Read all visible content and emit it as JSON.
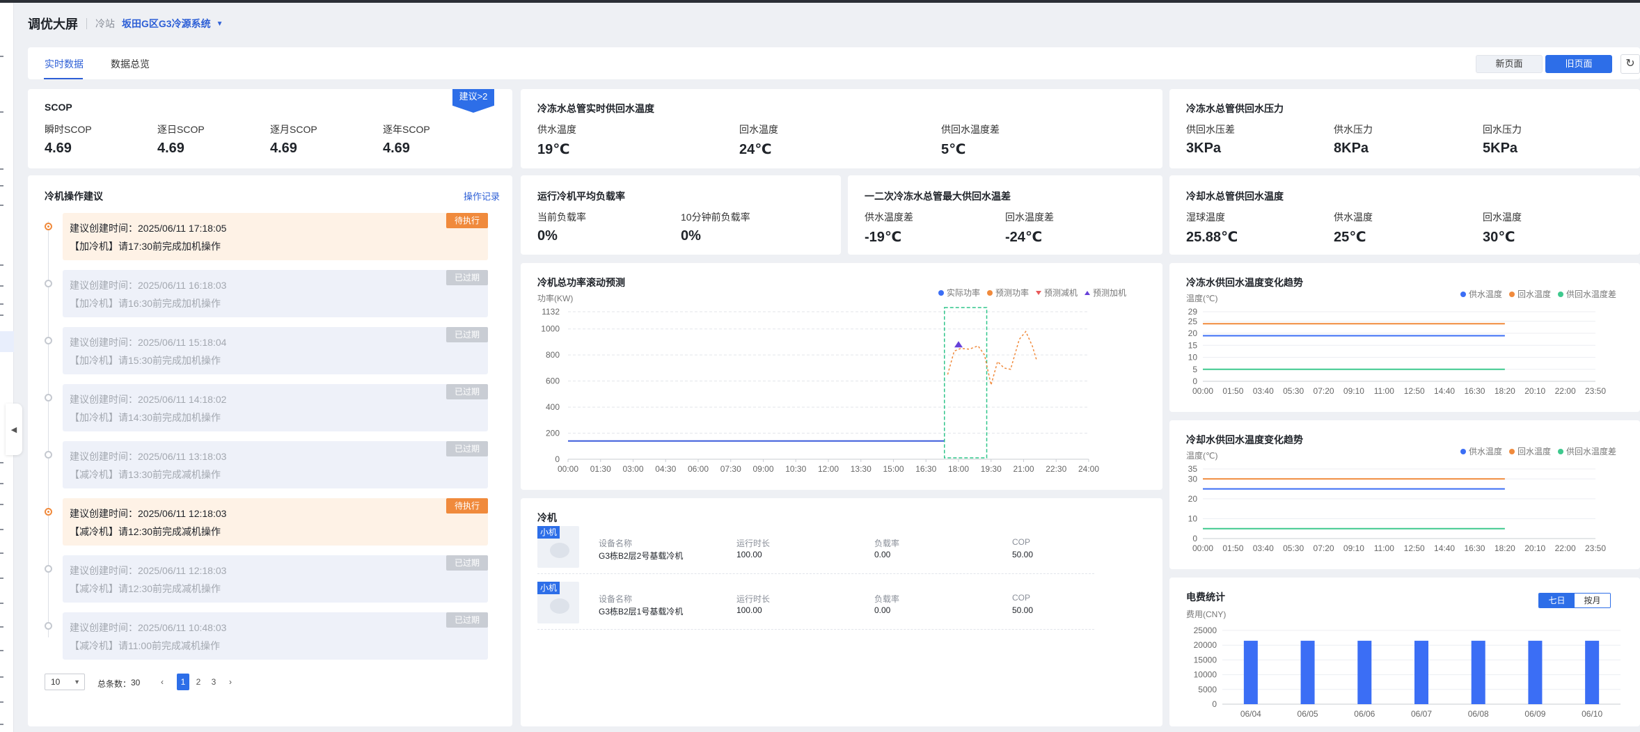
{
  "header": {
    "title": "调优大屏",
    "station_label": "冷站",
    "station_value": "坂田G区G3冷源系统"
  },
  "tabs": [
    {
      "label": "实时数据",
      "active": true
    },
    {
      "label": "数据总览",
      "active": false
    }
  ],
  "actions": {
    "new_page": "新页面",
    "old_page": "旧页面"
  },
  "scop": {
    "title": "SCOP",
    "badge": "建议>2",
    "metrics": [
      {
        "label": "瞬时SCOP",
        "value": "4.69"
      },
      {
        "label": "逐日SCOP",
        "value": "4.69"
      },
      {
        "label": "逐月SCOP",
        "value": "4.69"
      },
      {
        "label": "逐年SCOP",
        "value": "4.69"
      }
    ]
  },
  "chw_temp": {
    "title": "冷冻水总管实时供回水温度",
    "metrics": [
      {
        "label": "供水温度",
        "value": "19℃"
      },
      {
        "label": "回水温度",
        "value": "24℃"
      },
      {
        "label": "供回水温度差",
        "value": "5℃"
      }
    ]
  },
  "chw_pressure": {
    "title": "冷冻水总管供回水压力",
    "metrics": [
      {
        "label": "供回水压差",
        "value": "3KPa"
      },
      {
        "label": "供水压力",
        "value": "8KPa"
      },
      {
        "label": "回水压力",
        "value": "5KPa"
      }
    ]
  },
  "load": {
    "title": "运行冷机平均负载率",
    "metrics": [
      {
        "label": "当前负载率",
        "value": "0%"
      },
      {
        "label": "10分钟前负载率",
        "value": "0%"
      }
    ]
  },
  "max_diff": {
    "title": "一二次冷冻水总管最大供回水温差",
    "metrics": [
      {
        "label": "供水温度差",
        "value": "-19℃"
      },
      {
        "label": "回水温度差",
        "value": "-24℃"
      }
    ]
  },
  "cw_temp": {
    "title": "冷却水总管供回水温度",
    "metrics": [
      {
        "label": "湿球温度",
        "value": "25.88℃"
      },
      {
        "label": "供水温度",
        "value": "25℃"
      },
      {
        "label": "回水温度",
        "value": "30℃"
      }
    ]
  },
  "suggestions": {
    "title": "冷机操作建议",
    "record_link": "操作记录",
    "items": [
      {
        "time": "建议创建时间：2025/06/11 17:18:05",
        "text": "【加冷机】请17:30前完成加机操作",
        "status": "待执行",
        "pending": true
      },
      {
        "time": "建议创建时间：2025/06/11 16:18:03",
        "text": "【加冷机】请16:30前完成加机操作",
        "status": "已过期",
        "pending": false
      },
      {
        "time": "建议创建时间：2025/06/11 15:18:04",
        "text": "【加冷机】请15:30前完成加机操作",
        "status": "已过期",
        "pending": false
      },
      {
        "time": "建议创建时间：2025/06/11 14:18:02",
        "text": "【加冷机】请14:30前完成加机操作",
        "status": "已过期",
        "pending": false
      },
      {
        "time": "建议创建时间：2025/06/11 13:18:03",
        "text": "【减冷机】请13:30前完成减机操作",
        "status": "已过期",
        "pending": false
      },
      {
        "time": "建议创建时间：2025/06/11 12:18:03",
        "text": "【减冷机】请12:30前完成减机操作",
        "status": "待执行",
        "pending": true
      },
      {
        "time": "建议创建时间：2025/06/11 12:18:03",
        "text": "【减冷机】请12:30前完成减机操作",
        "status": "已过期",
        "pending": false
      },
      {
        "time": "建议创建时间：2025/06/11 10:48:03",
        "text": "【减冷机】请11:00前完成减机操作",
        "status": "已过期",
        "pending": false
      }
    ]
  },
  "pagination": {
    "page_size": "10",
    "total_label": "总条数：",
    "total": "30",
    "pages": [
      "1",
      "2",
      "3"
    ],
    "current": "1",
    "prev": "‹",
    "next": "›"
  },
  "chillers": {
    "title": "冷机",
    "items": [
      {
        "badge": "小机",
        "name_label": "设备名称",
        "name": "G3栋B2层2号基载冷机",
        "runtime_label": "运行时长",
        "runtime": "100.00",
        "load_label": "负载率",
        "load": "0.00",
        "cop_label": "COP",
        "cop": "50.00"
      },
      {
        "badge": "小机",
        "name_label": "设备名称",
        "name": "G3栋B2层1号基载冷机",
        "runtime_label": "运行时长",
        "runtime": "100.00",
        "load_label": "负载率",
        "load": "0.00",
        "cop_label": "COP",
        "cop": "50.00"
      }
    ]
  },
  "chart_data": [
    {
      "id": "power",
      "type": "line",
      "title": "冷机总功率滚动预测",
      "ylabel": "功率(KW)",
      "legend_position": "top-right",
      "legend": [
        "实际功率",
        "预测功率",
        "预测减机",
        "预测加机"
      ],
      "x_ticks": [
        "00:00",
        "01:30",
        "03:00",
        "04:30",
        "06:00",
        "07:30",
        "09:00",
        "10:30",
        "12:00",
        "13:30",
        "15:00",
        "16:30",
        "18:00",
        "19:30",
        "21:00",
        "22:30",
        "24:00"
      ],
      "y_ticks": [
        0,
        200,
        400,
        600,
        800,
        1000,
        1132
      ],
      "ylim": [
        0,
        1132
      ],
      "series": [
        {
          "name": "实际功率",
          "color": "#3b5bdb",
          "points": [
            [
              0,
              140
            ],
            [
              17.33,
              140
            ]
          ]
        },
        {
          "name": "预测功率",
          "color": "#f08a3c",
          "dashed": true,
          "points": [
            [
              17.5,
              650
            ],
            [
              17.8,
              830
            ],
            [
              18.1,
              850
            ],
            [
              18.5,
              845
            ],
            [
              18.9,
              870
            ],
            [
              19.2,
              800
            ],
            [
              19.5,
              570
            ],
            [
              19.8,
              750
            ],
            [
              20.1,
              700
            ],
            [
              20.4,
              690
            ],
            [
              20.8,
              920
            ],
            [
              21.1,
              980
            ],
            [
              21.4,
              870
            ],
            [
              21.6,
              760
            ]
          ]
        },
        {
          "name": "预测加机",
          "color": "#6741d9",
          "points": [
            [
              18,
              880
            ]
          ]
        }
      ],
      "prediction_window": [
        17.35,
        19.3
      ],
      "grid": true
    },
    {
      "id": "chw_trend",
      "type": "line",
      "title": "冷冻水供回水温度变化趋势",
      "ylabel": "温度(℃)",
      "legend_position": "top-right",
      "x_ticks": [
        "00:00",
        "01:50",
        "03:40",
        "05:30",
        "07:20",
        "09:10",
        "11:00",
        "12:50",
        "14:40",
        "16:30",
        "18:20",
        "20:10",
        "22:00",
        "23:50"
      ],
      "y_ticks": [
        0,
        5,
        10,
        15,
        20,
        25,
        29
      ],
      "ylim": [
        0,
        29
      ],
      "series": [
        {
          "name": "供水温度",
          "color": "#3b6ef5",
          "values_until": "18:20",
          "value": 19
        },
        {
          "name": "回水温度",
          "color": "#f08a3c",
          "value": 24
        },
        {
          "name": "供回水温度差",
          "color": "#3ec98e",
          "value": 5
        }
      ]
    },
    {
      "id": "cw_trend",
      "type": "line",
      "title": "冷却水供回水温度变化趋势",
      "ylabel": "温度(℃)",
      "legend_position": "top-right",
      "x_ticks": [
        "00:00",
        "01:50",
        "03:40",
        "05:30",
        "07:20",
        "09:10",
        "11:00",
        "12:50",
        "14:40",
        "16:30",
        "18:20",
        "20:10",
        "22:00",
        "23:50"
      ],
      "y_ticks": [
        0,
        10,
        20,
        30,
        35
      ],
      "ylim": [
        0,
        35
      ],
      "series": [
        {
          "name": "供水温度",
          "color": "#3b6ef5",
          "value": 25
        },
        {
          "name": "回水温度",
          "color": "#f08a3c",
          "value": 30
        },
        {
          "name": "供回水温度差",
          "color": "#3ec98e",
          "value": 5
        }
      ]
    },
    {
      "id": "fee",
      "type": "bar",
      "title": "电费统计",
      "ylabel": "费用(CNY)",
      "toggle": [
        "七日",
        "按月"
      ],
      "categories": [
        "06/04",
        "06/05",
        "06/06",
        "06/07",
        "06/08",
        "06/09",
        "06/10"
      ],
      "values": [
        21500,
        21500,
        21500,
        21500,
        21500,
        21500,
        21500
      ],
      "y_ticks": [
        0,
        5000,
        10000,
        15000,
        20000,
        25000
      ],
      "ylim": [
        0,
        25000
      ],
      "color": "#3b6ef5"
    }
  ]
}
